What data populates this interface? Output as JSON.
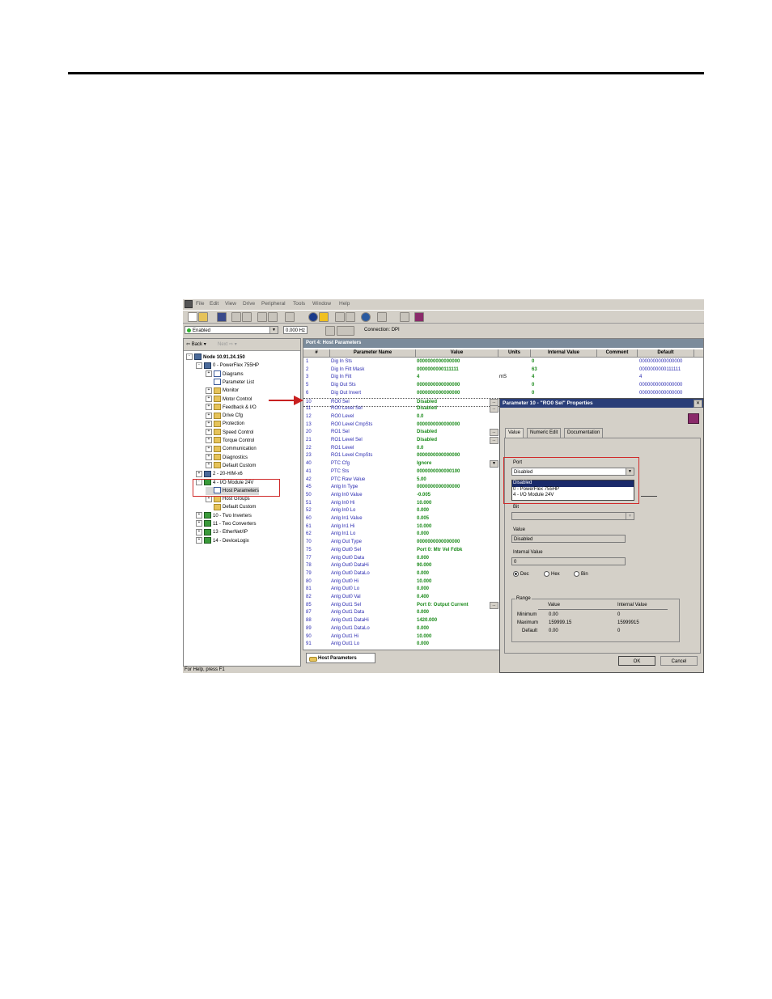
{
  "menu": [
    "File",
    "Edit",
    "View",
    "Drive",
    "Peripheral",
    "Tools",
    "Window",
    "Help"
  ],
  "status": {
    "state": "Enabled",
    "frequency": "0.000 Hz",
    "connection": "Connection: DPI"
  },
  "nav": {
    "back": "Back",
    "next": "Next"
  },
  "tree": [
    {
      "label": "Node 10.91.24.150",
      "level": 0,
      "icon": "network-icon",
      "exp": "-"
    },
    {
      "label": "0 - PowerFlex 755HP",
      "level": 1,
      "icon": "drive-icon",
      "exp": "-"
    },
    {
      "label": "Diagrams",
      "level": 2,
      "icon": "diagram-icon",
      "exp": "+"
    },
    {
      "label": "Parameter List",
      "level": 2,
      "icon": "list-icon",
      "exp": ""
    },
    {
      "label": "Monitor",
      "level": 2,
      "icon": "folder-icon",
      "exp": "+"
    },
    {
      "label": "Motor Control",
      "level": 2,
      "icon": "folder-icon",
      "exp": "+"
    },
    {
      "label": "Feedback & I/O",
      "level": 2,
      "icon": "folder-icon",
      "exp": "+"
    },
    {
      "label": "Drive Cfg",
      "level": 2,
      "icon": "folder-icon",
      "exp": "+"
    },
    {
      "label": "Protection",
      "level": 2,
      "icon": "folder-icon",
      "exp": "+"
    },
    {
      "label": "Speed Control",
      "level": 2,
      "icon": "folder-icon",
      "exp": "+"
    },
    {
      "label": "Torque Control",
      "level": 2,
      "icon": "folder-icon",
      "exp": "+"
    },
    {
      "label": "Communication",
      "level": 2,
      "icon": "folder-icon",
      "exp": "+"
    },
    {
      "label": "Diagnostics",
      "level": 2,
      "icon": "folder-icon",
      "exp": "+"
    },
    {
      "label": "Default Custom",
      "level": 2,
      "icon": "folder-icon",
      "exp": "+"
    },
    {
      "label": "2 - 20-HIM-x6",
      "level": 1,
      "icon": "drive-icon",
      "exp": "+"
    },
    {
      "label": "4 - I/O Module 24V",
      "level": 1,
      "icon": "module-icon",
      "exp": "-"
    },
    {
      "label": "Host Parameters",
      "level": 2,
      "icon": "list-icon",
      "exp": ""
    },
    {
      "label": "Host Groups",
      "level": 2,
      "icon": "folder-icon",
      "exp": "+"
    },
    {
      "label": "Default Custom",
      "level": 2,
      "icon": "folder-icon",
      "exp": ""
    },
    {
      "label": "10 - Two Inverters",
      "level": 1,
      "icon": "module-icon",
      "exp": "+"
    },
    {
      "label": "11 - Two Converters",
      "level": 1,
      "icon": "module-icon",
      "exp": "+"
    },
    {
      "label": "13 - EtherNet/IP",
      "level": 1,
      "icon": "ethernet-icon",
      "exp": "+"
    },
    {
      "label": "14 - DeviceLogix",
      "level": 1,
      "icon": "module-icon",
      "exp": "+"
    }
  ],
  "grid": {
    "title": "Port 4: Host Parameters",
    "headers": [
      "#",
      "Parameter Name",
      "Value",
      "Units",
      "Internal Value",
      "Comment",
      "Default"
    ],
    "rows": [
      {
        "num": "1",
        "name": "Dig In Sts",
        "value": "0000000000000000",
        "units": "",
        "iv": "0",
        "def": "0000000000000000",
        "ell": false
      },
      {
        "num": "2",
        "name": "Dig In Filt Mask",
        "value": "0000000000111111",
        "units": "",
        "iv": "63",
        "def": "0000000000111111",
        "ell": false
      },
      {
        "num": "3",
        "name": "Dig In Filt",
        "value": "4",
        "units": "mS",
        "iv": "4",
        "def": "4",
        "ell": false
      },
      {
        "num": "5",
        "name": "Dig Out Sts",
        "value": "0000000000000000",
        "units": "",
        "iv": "0",
        "def": "0000000000000000",
        "ell": false
      },
      {
        "num": "6",
        "name": "Dig Out Invert",
        "value": "0000000000000000",
        "units": "",
        "iv": "0",
        "def": "0000000000000000",
        "ell": false
      },
      {
        "num": "10",
        "name": "RO0 Sel",
        "value": "Disabled",
        "units": "",
        "iv": "",
        "def": "",
        "ell": true
      },
      {
        "num": "11",
        "name": "RO0 Level Sel",
        "value": "Disabled",
        "units": "",
        "iv": "",
        "def": "",
        "ell": true
      },
      {
        "num": "12",
        "name": "RO0 Level",
        "value": "0.0",
        "units": "",
        "iv": "",
        "def": "",
        "ell": false
      },
      {
        "num": "13",
        "name": "RO0 Level CmpSts",
        "value": "0000000000000000",
        "units": "",
        "iv": "",
        "def": "",
        "ell": false
      },
      {
        "num": "20",
        "name": "RO1 Sel",
        "value": "Disabled",
        "units": "",
        "iv": "",
        "def": "",
        "ell": true
      },
      {
        "num": "21",
        "name": "RO1 Level Sel",
        "value": "Disabled",
        "units": "",
        "iv": "",
        "def": "",
        "ell": true
      },
      {
        "num": "22",
        "name": "RO1 Level",
        "value": "0.0",
        "units": "",
        "iv": "",
        "def": "",
        "ell": false
      },
      {
        "num": "23",
        "name": "RO1 Level CmpSts",
        "value": "0000000000000000",
        "units": "",
        "iv": "",
        "def": "",
        "ell": false
      },
      {
        "num": "40",
        "name": "PTC Cfg",
        "value": "Ignore",
        "units": "",
        "iv": "",
        "def": "",
        "ell": false,
        "dd": true
      },
      {
        "num": "41",
        "name": "PTC Sts",
        "value": "0000000000000100",
        "units": "",
        "iv": "",
        "def": "",
        "ell": false
      },
      {
        "num": "42",
        "name": "PTC Raw Value",
        "value": "5.00",
        "units": "",
        "iv": "",
        "def": "",
        "ell": false
      },
      {
        "num": "45",
        "name": "Anlg In Type",
        "value": "0000000000000000",
        "units": "",
        "iv": "",
        "def": "",
        "ell": false
      },
      {
        "num": "50",
        "name": "Anlg In0 Value",
        "value": "-0.005",
        "units": "",
        "iv": "",
        "def": "",
        "ell": false
      },
      {
        "num": "51",
        "name": "Anlg In0 Hi",
        "value": "10.000",
        "units": "",
        "iv": "",
        "def": "",
        "ell": false
      },
      {
        "num": "52",
        "name": "Anlg In0 Lo",
        "value": "0.000",
        "units": "",
        "iv": "",
        "def": "",
        "ell": false
      },
      {
        "num": "60",
        "name": "Anlg In1 Value",
        "value": "0.005",
        "units": "",
        "iv": "",
        "def": "",
        "ell": false
      },
      {
        "num": "61",
        "name": "Anlg In1 Hi",
        "value": "10.000",
        "units": "",
        "iv": "",
        "def": "",
        "ell": false
      },
      {
        "num": "62",
        "name": "Anlg In1 Lo",
        "value": "0.000",
        "units": "",
        "iv": "",
        "def": "",
        "ell": false
      },
      {
        "num": "70",
        "name": "Anlg Out Type",
        "value": "0000000000000000",
        "units": "",
        "iv": "",
        "def": "",
        "ell": false
      },
      {
        "num": "75",
        "name": "Anlg Out0 Sel",
        "value": "Port 0: Mtr Vel Fdbk",
        "units": "",
        "iv": "",
        "def": "",
        "ell": false
      },
      {
        "num": "77",
        "name": "Anlg Out0 Data",
        "value": "0.000",
        "units": "",
        "iv": "",
        "def": "",
        "ell": false
      },
      {
        "num": "78",
        "name": "Anlg Out0 DataHi",
        "value": "90.000",
        "units": "",
        "iv": "",
        "def": "",
        "ell": false
      },
      {
        "num": "79",
        "name": "Anlg Out0 DataLo",
        "value": "0.000",
        "units": "",
        "iv": "",
        "def": "",
        "ell": false
      },
      {
        "num": "80",
        "name": "Anlg Out0 Hi",
        "value": "10.000",
        "units": "",
        "iv": "",
        "def": "",
        "ell": false
      },
      {
        "num": "81",
        "name": "Anlg Out0 Lo",
        "value": "0.000",
        "units": "",
        "iv": "",
        "def": "",
        "ell": false
      },
      {
        "num": "82",
        "name": "Anlg Out0 Val",
        "value": "0.400",
        "units": "",
        "iv": "",
        "def": "",
        "ell": false
      },
      {
        "num": "85",
        "name": "Anlg Out1 Sel",
        "value": "Port 0: Output Current",
        "units": "",
        "iv": "",
        "def": "",
        "ell": true
      },
      {
        "num": "87",
        "name": "Anlg Out1 Data",
        "value": "0.000",
        "units": "",
        "iv": "",
        "def": "",
        "ell": false
      },
      {
        "num": "88",
        "name": "Anlg Out1 DataHi",
        "value": "1420.000",
        "units": "",
        "iv": "",
        "def": "",
        "ell": false
      },
      {
        "num": "89",
        "name": "Anlg Out1 DataLo",
        "value": "0.000",
        "units": "",
        "iv": "",
        "def": "",
        "ell": false
      },
      {
        "num": "90",
        "name": "Anlg Out1 Hi",
        "value": "10.000",
        "units": "",
        "iv": "",
        "def": "",
        "ell": false
      },
      {
        "num": "91",
        "name": "Anlg Out1 Lo",
        "value": "0.000",
        "units": "",
        "iv": "",
        "def": "",
        "ell": false
      }
    ],
    "tab": "Host Parameters"
  },
  "help": "For Help, press F1",
  "dialog": {
    "title": "Parameter 10 - \"RO0 Sel\" Properties",
    "tabs": [
      "Value",
      "Numeric Edit",
      "Documentation"
    ],
    "port_label": "Port",
    "port_value": "Disabled",
    "port_options": [
      "Disabled",
      "0 - PowerFlex 755HP",
      "4 - I/O Module 24V"
    ],
    "bit_label": "Bit",
    "value_label": "Value",
    "value": "Disabled",
    "iv_label": "Internal Value",
    "iv": "0",
    "radios": [
      "Dec",
      "Hex",
      "Bin"
    ],
    "range": {
      "title": "Range",
      "col_value": "Value",
      "col_iv": "Internal Value",
      "rows": [
        {
          "label": "Minimum",
          "value": "0.00",
          "iv": "0"
        },
        {
          "label": "Maximum",
          "value": "159999.15",
          "iv": "15999915"
        },
        {
          "label": "Default",
          "value": "0.00",
          "iv": "0"
        }
      ]
    },
    "ok": "OK",
    "cancel": "Cancel"
  }
}
